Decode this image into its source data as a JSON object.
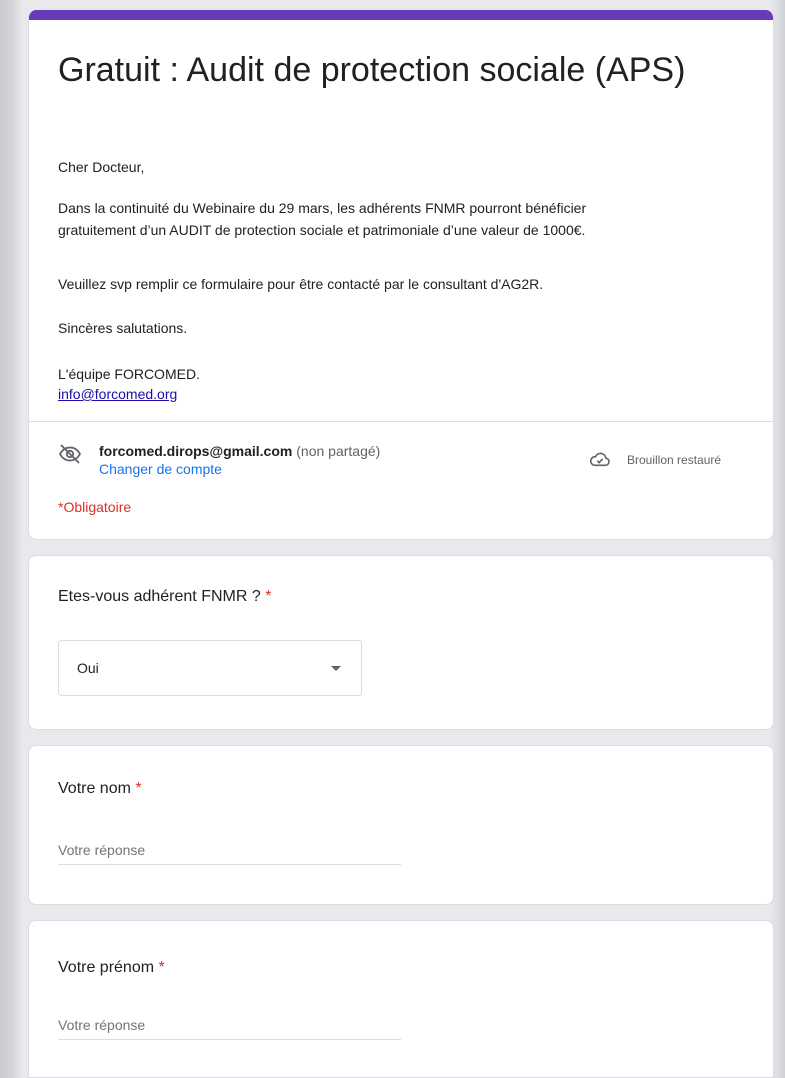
{
  "form": {
    "title": "Gratuit : Audit de protection sociale (APS)",
    "description": {
      "greeting": "Cher Docteur,",
      "paragraph1_line1": "Dans la continuité du Webinaire du 29 mars, les adhérents FNMR pourront bénéficier",
      "paragraph1_line2": "gratuitement d’un AUDIT de protection sociale et patrimoniale d’une valeur de 1000€.",
      "paragraph2": "Veuillez svp remplir ce formulaire pour être contacté par le consultant d'AG2R.",
      "closing": "Sincères salutations.",
      "signature": "L'équipe FORCOMED.",
      "email_link": "info@forcomed.org"
    },
    "account": {
      "email": "forcomed.dirops@gmail.com",
      "note": " (non partagé)",
      "switch_label": "Changer de compte",
      "draft_status": "Brouillon restauré"
    },
    "required_note": "*Obligatoire"
  },
  "questions": [
    {
      "label": "Etes-vous adhérent FNMR ?",
      "required_mark": "*",
      "type": "dropdown",
      "selected": "Oui"
    },
    {
      "label": "Votre nom",
      "required_mark": "*",
      "type": "text",
      "placeholder": "Votre réponse"
    },
    {
      "label": "Votre prénom",
      "required_mark": "*",
      "type": "text",
      "placeholder": "Votre réponse"
    }
  ],
  "colors": {
    "accent": "#673ab7",
    "required": "#d93025",
    "link": "#1a73e8"
  },
  "icons": [
    "visibility-off-icon",
    "cloud-done-icon",
    "arrow-drop-down-icon"
  ]
}
